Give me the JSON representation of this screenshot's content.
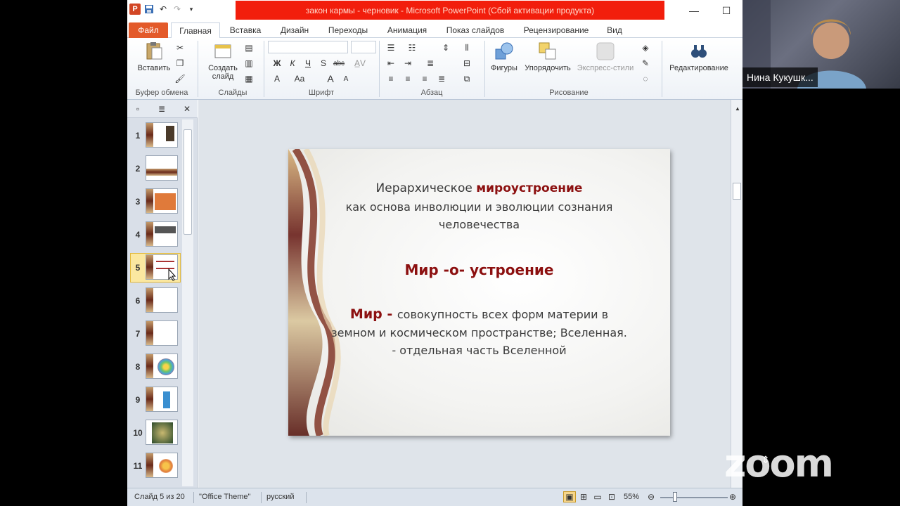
{
  "window": {
    "title": "закон кармы - черновик  -  Microsoft PowerPoint (Сбой активации продукта)",
    "title_bg": "#f21e0c"
  },
  "tabs": [
    "Файл",
    "Главная",
    "Вставка",
    "Дизайн",
    "Переходы",
    "Анимация",
    "Показ слайдов",
    "Рецензирование",
    "Вид"
  ],
  "ribbon": {
    "paste": "Вставить",
    "new_slide_line1": "Создать",
    "new_slide_line2": "слайд",
    "shapes": "Фигуры",
    "arrange": "Упорядочить",
    "quick_styles": "Экспресс-стили",
    "editing": "Редактирование",
    "groups": {
      "clipboard": "Буфер обмена",
      "slides": "Слайды",
      "font": "Шрифт",
      "paragraph": "Абзац",
      "drawing": "Рисование"
    },
    "font_buttons": [
      "Ж",
      "К",
      "Ч",
      "S",
      "abc",
      "A",
      "Aa",
      "A"
    ]
  },
  "slides_panel": {
    "numbers": [
      "1",
      "2",
      "3",
      "4",
      "5",
      "6",
      "7",
      "8",
      "9",
      "10",
      "11"
    ],
    "selected": "5"
  },
  "slide": {
    "line1_plain": "Иерархическое ",
    "line1_bold": "мироустроение",
    "line2": "как основа инволюции и эволюции сознания",
    "line3": "человечества",
    "heading": "Мир -о- устроение",
    "def_term": "Мир - ",
    "def_line1": " совокупность всех форм материи в",
    "def_line2": "земном и космическом пространстве; Вселенная.",
    "def_line3": "- отдельная часть Вселенной"
  },
  "status": {
    "slide_of": "Слайд 5 из 20",
    "theme": "\"Office Theme\"",
    "language": "русский",
    "zoom": "55%"
  },
  "zoom_app": {
    "logo": "zoom",
    "participant_name": "Нина Кукушк..."
  }
}
